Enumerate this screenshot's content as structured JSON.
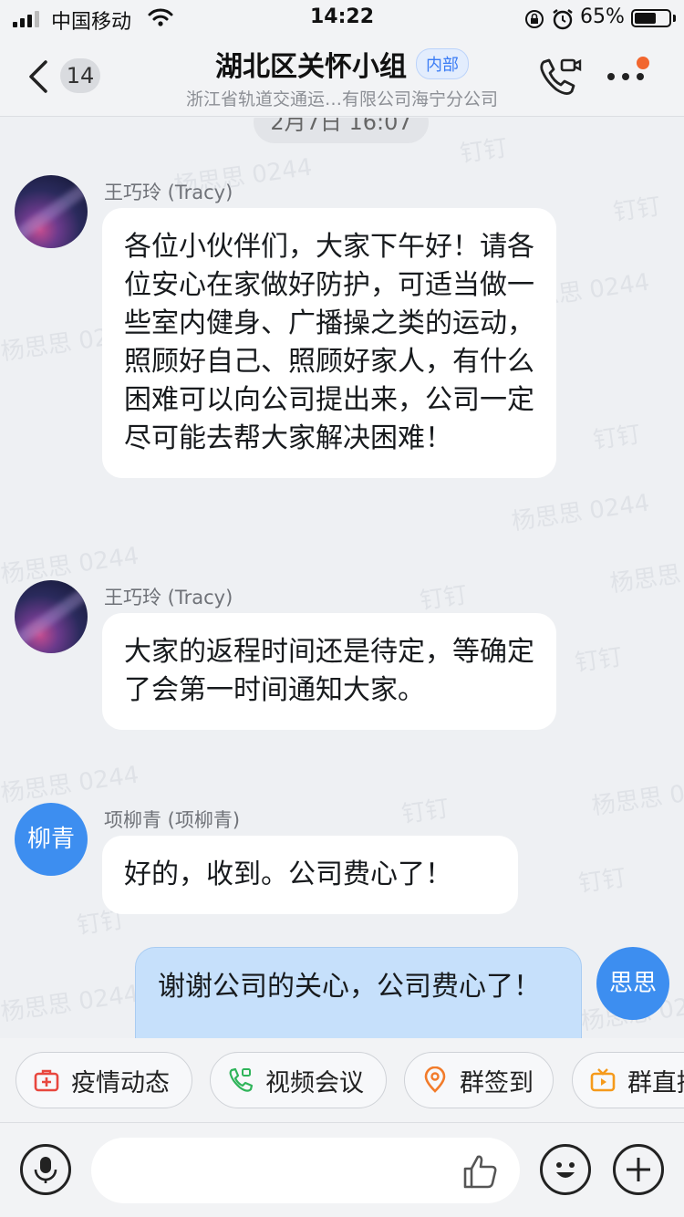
{
  "status_bar": {
    "carrier": "中国移动",
    "time": "14:22",
    "battery_text": "65%",
    "battery_level": 0.65,
    "icons": [
      "signal-icon",
      "wifi-icon",
      "rotation-lock-icon",
      "alarm-icon",
      "battery-icon"
    ]
  },
  "header": {
    "back_count": "14",
    "title": "湖北区关怀小组",
    "tag": "内部",
    "subtitle": "浙江省轨道交通运…有限公司海宁分公司",
    "icons": [
      "back-chevron-icon",
      "video-call-icon",
      "more-icon"
    ],
    "accent_color": "#3a7cf5",
    "notification_dot_color": "#f2662e"
  },
  "chat": {
    "timestamp": "2月7日 16:07",
    "watermarks": [
      "杨思思 0244",
      "钉钉"
    ],
    "messages": [
      {
        "sender": "王巧玲 (Tracy)",
        "avatar": "galaxy",
        "text": "各位小伙伴们，大家下午好！请各位安心在家做好防护，可适当做一些室内健身、广播操之类的运动，照顾好自己、照顾好家人，有什么困难可以向公司提出来，公司一定尽可能去帮大家解决困难！"
      },
      {
        "sender": "王巧玲 (Tracy)",
        "avatar": "galaxy",
        "text": "大家的返程时间还是待定，等确定了会第一时间通知大家。"
      },
      {
        "sender": "项柳青 (项柳青)",
        "avatar_text": "柳青",
        "text": "好的，收到。公司费心了！"
      },
      {
        "mine": true,
        "avatar_text": "思思",
        "text": "谢谢公司的关心，公司费心了！"
      }
    ]
  },
  "quick_actions": [
    {
      "label": "疫情动态",
      "icon": "medical-kit-icon",
      "color": "#e8473e"
    },
    {
      "label": "视频会议",
      "icon": "video-meeting-icon",
      "color": "#2fb45a"
    },
    {
      "label": "群签到",
      "icon": "location-pin-icon",
      "color": "#f27b2a"
    },
    {
      "label": "群直播",
      "icon": "live-tv-icon",
      "color": "#f59a1b"
    }
  ],
  "input_bar": {
    "icons": [
      "voice-icon",
      "thumbs-up-icon",
      "emoji-icon",
      "add-icon"
    ],
    "placeholder": ""
  }
}
